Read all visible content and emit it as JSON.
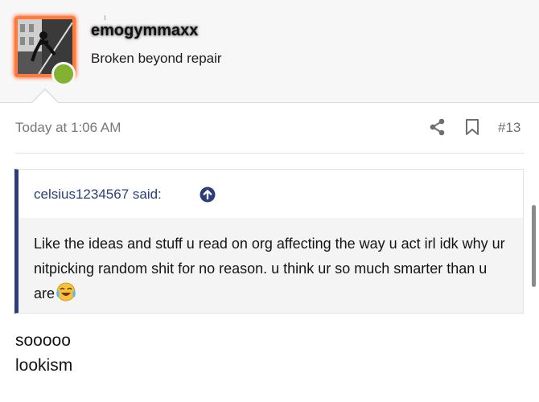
{
  "user": {
    "username": "emogymmaxx",
    "title": "Broken beyond repair",
    "status": "online",
    "accent_color": "#ff7a3d",
    "online_color": "#83b233"
  },
  "post": {
    "timestamp": "Today at 1:06 AM",
    "number": "#13",
    "actions": {
      "share_icon": "share-icon",
      "bookmark_icon": "bookmark-icon"
    }
  },
  "quote": {
    "author_label": "celsius1234567 said:",
    "text": "Like the ideas and stuff u read on org affecting the way u act irl idk why ur nitpicking random shit for no reason. u think ur so much smarter than u are",
    "emoji": "crying-laughing-emoji",
    "border_color": "#2b3e7a"
  },
  "reply": {
    "lines": [
      "sooooo",
      "lookism"
    ]
  }
}
